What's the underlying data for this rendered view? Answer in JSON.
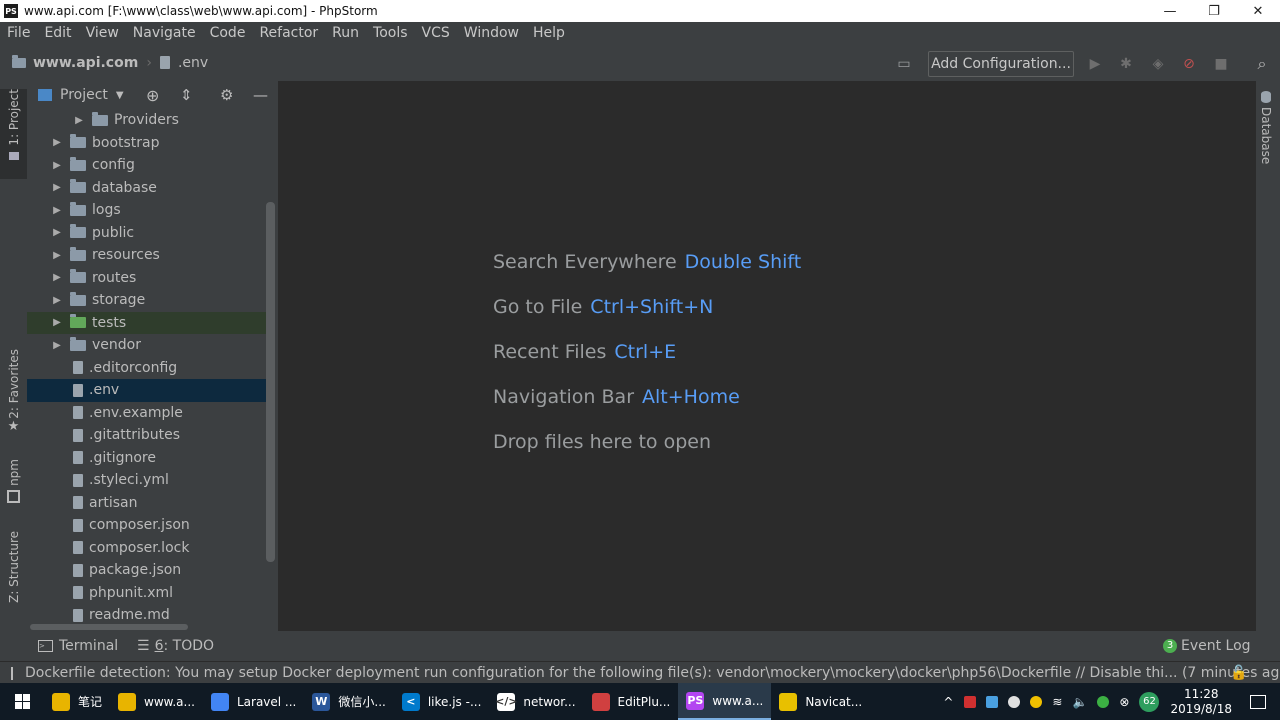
{
  "window": {
    "title": "www.api.com [F:\\www\\class\\web\\www.api.com] - PhpStorm",
    "logo_text": "PS",
    "minimize": "—",
    "restore": "❐",
    "close": "✕"
  },
  "menu": [
    "File",
    "Edit",
    "View",
    "Navigate",
    "Code",
    "Refactor",
    "Run",
    "Tools",
    "VCS",
    "Window",
    "Help"
  ],
  "breadcrumb": {
    "project": "www.api.com",
    "file": ".env"
  },
  "toolbar": {
    "add_config_label": "Add Configuration..."
  },
  "left_tabs": {
    "project": "1: Project",
    "favorites": "2: Favorites",
    "npm": "npm",
    "structure": "Z: Structure"
  },
  "right_tabs": {
    "database": "Database"
  },
  "project_panel": {
    "view_label": "Project",
    "tree": [
      {
        "label": "Providers",
        "type": "folder",
        "expandable": true
      },
      {
        "label": "bootstrap",
        "type": "folder",
        "expandable": true
      },
      {
        "label": "config",
        "type": "folder",
        "expandable": true
      },
      {
        "label": "database",
        "type": "folder",
        "expandable": true
      },
      {
        "label": "logs",
        "type": "folder",
        "expandable": true
      },
      {
        "label": "public",
        "type": "folder",
        "expandable": true
      },
      {
        "label": "resources",
        "type": "folder",
        "expandable": true
      },
      {
        "label": "routes",
        "type": "folder",
        "expandable": true
      },
      {
        "label": "storage",
        "type": "folder",
        "expandable": true
      },
      {
        "label": "tests",
        "type": "folder",
        "expandable": true
      },
      {
        "label": "vendor",
        "type": "folder",
        "expandable": true
      },
      {
        "label": ".editorconfig",
        "type": "file",
        "expandable": false
      },
      {
        "label": ".env",
        "type": "file",
        "expandable": false
      },
      {
        "label": ".env.example",
        "type": "file",
        "expandable": false
      },
      {
        "label": ".gitattributes",
        "type": "file",
        "expandable": false
      },
      {
        "label": ".gitignore",
        "type": "file",
        "expandable": false
      },
      {
        "label": ".styleci.yml",
        "type": "file",
        "expandable": false
      },
      {
        "label": "artisan",
        "type": "file",
        "expandable": false
      },
      {
        "label": "composer.json",
        "type": "file",
        "expandable": false
      },
      {
        "label": "composer.lock",
        "type": "file",
        "expandable": false
      },
      {
        "label": "package.json",
        "type": "file",
        "expandable": false
      },
      {
        "label": "phpunit.xml",
        "type": "file",
        "expandable": false
      },
      {
        "label": "readme.md",
        "type": "file",
        "expandable": false
      }
    ]
  },
  "editor_hints": [
    {
      "action": "Search Everywhere",
      "key": "Double Shift"
    },
    {
      "action": "Go to File",
      "key": "Ctrl+Shift+N"
    },
    {
      "action": "Recent Files",
      "key": "Ctrl+E"
    },
    {
      "action": "Navigation Bar",
      "key": "Alt+Home"
    },
    {
      "action": "Drop files here to open",
      "key": ""
    }
  ],
  "bottom_tools": {
    "terminal": "Terminal",
    "todo_num": "6",
    "todo": ": TODO",
    "event_log": "Event Log",
    "event_count": "3"
  },
  "status": {
    "message": "Dockerfile detection: You may setup Docker deployment run configuration for the following file(s): vendor\\mockery\\mockery\\docker\\php56\\Dockerfile // Disable thi... (7 minutes ago)"
  },
  "taskbar": {
    "items": [
      {
        "label": "笔记",
        "icon_color": "#e8b400",
        "icon_text": ""
      },
      {
        "label": "www.a...",
        "icon_color": "#e8b400",
        "icon_text": ""
      },
      {
        "label": "Laravel ...",
        "icon_color": "#4285f4",
        "icon_text": ""
      },
      {
        "label": "微信小...",
        "icon_color": "#2b579a",
        "icon_text": "W"
      },
      {
        "label": "like.js -...",
        "icon_color": "#007acc",
        "icon_text": "<"
      },
      {
        "label": "networ...",
        "icon_color": "#ffffff",
        "icon_text": "</>"
      },
      {
        "label": "EditPlu...",
        "icon_color": "#d04040",
        "icon_text": ""
      },
      {
        "label": "www.a...",
        "icon_color": "#b345f1",
        "icon_text": "PS"
      },
      {
        "label": "Navicat...",
        "icon_color": "#e8c000",
        "icon_text": ""
      }
    ],
    "time": "11:28",
    "date": "2019/8/18",
    "tray_badge": "62"
  }
}
